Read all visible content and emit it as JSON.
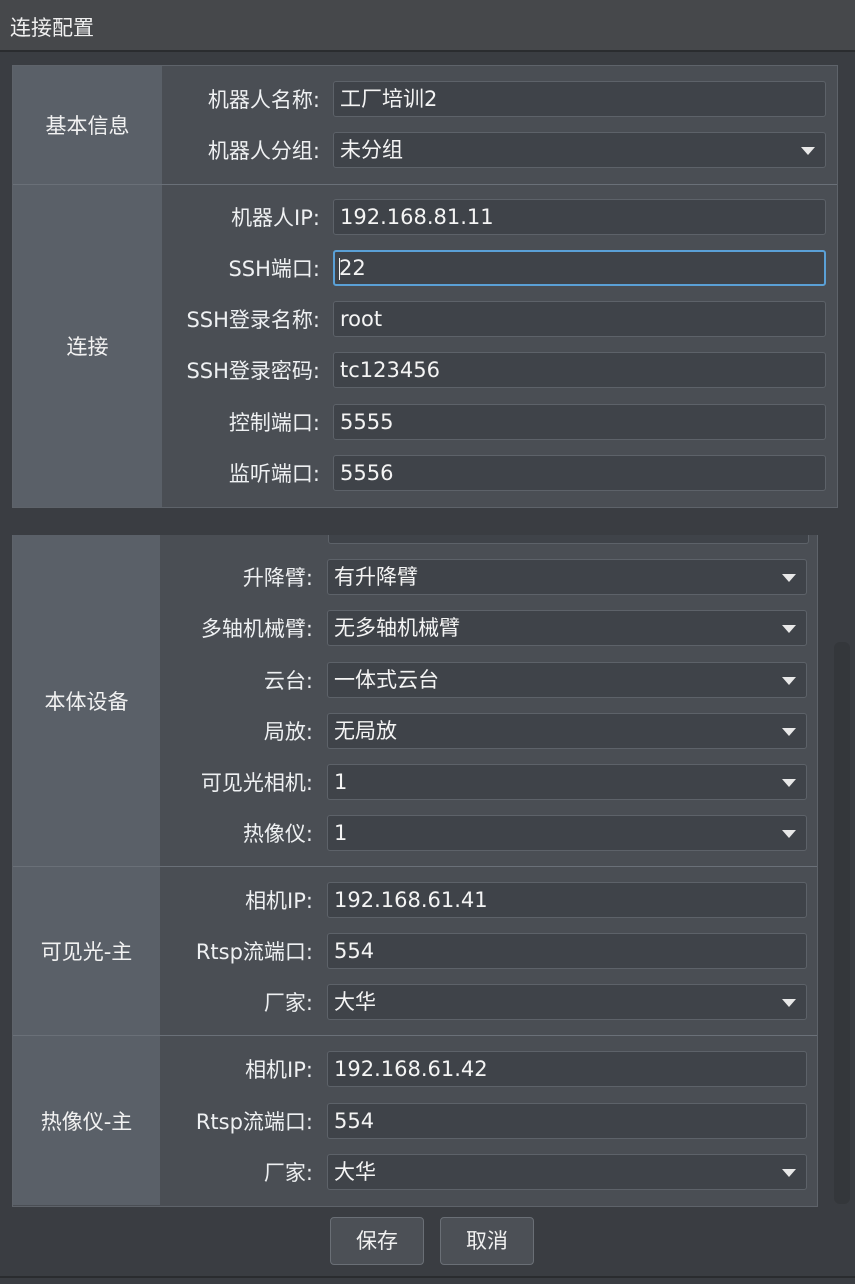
{
  "window": {
    "title": "连接配置"
  },
  "basic": {
    "section_label": "基本信息",
    "rows": [
      {
        "label": "机器人名称:",
        "value": "工厂培训2"
      },
      {
        "label": "机器人分组:",
        "value": "未分组"
      }
    ]
  },
  "connection": {
    "section_label": "连接",
    "rows": [
      {
        "label": "机器人IP:",
        "value": "192.168.81.11"
      },
      {
        "label": "SSH端口:",
        "value": "22"
      },
      {
        "label": "SSH登录名称:",
        "value": "root"
      },
      {
        "label": "SSH登录密码:",
        "value": "tc123456"
      },
      {
        "label": "控制端口:",
        "value": "5555"
      },
      {
        "label": "监听端口:",
        "value": "5556"
      }
    ]
  },
  "body_device": {
    "section_label": "本体设备",
    "rows": [
      {
        "label": "升降臂:",
        "value": "有升降臂"
      },
      {
        "label": "多轴机械臂:",
        "value": "无多轴机械臂"
      },
      {
        "label": "云台:",
        "value": "一体式云台"
      },
      {
        "label": "局放:",
        "value": "无局放"
      },
      {
        "label": "可见光相机:",
        "value": "1"
      },
      {
        "label": "热像仪:",
        "value": "1"
      }
    ]
  },
  "visible_main": {
    "section_label": "可见光-主",
    "rows": [
      {
        "label": "相机IP:",
        "value": "192.168.61.41"
      },
      {
        "label": "Rtsp流端口:",
        "value": "554"
      },
      {
        "label": "厂家:",
        "value": "大华"
      }
    ]
  },
  "thermal_main": {
    "section_label": "热像仪-主",
    "rows": [
      {
        "label": "相机IP:",
        "value": "192.168.61.42"
      },
      {
        "label": "Rtsp流端口:",
        "value": "554"
      },
      {
        "label": "厂家:",
        "value": "大华"
      }
    ]
  },
  "buttons": {
    "save": "保存",
    "cancel": "取消"
  },
  "colors": {
    "focus_border": "#5aa0d6",
    "background": "#3a3d42",
    "section_label_bg": "#5a6068"
  }
}
